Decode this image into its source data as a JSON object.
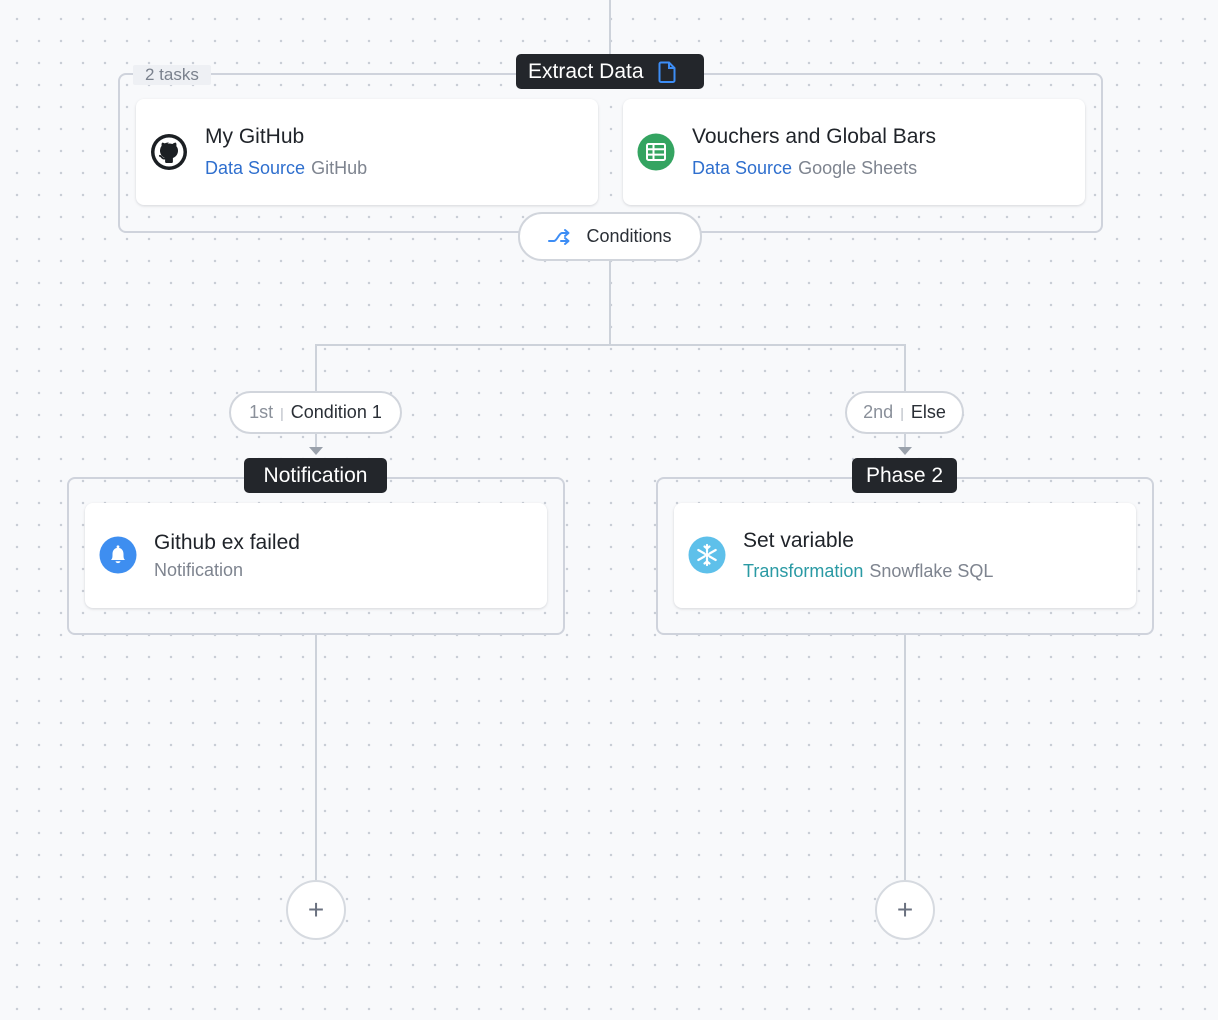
{
  "phases": {
    "extract": {
      "title": "Extract Data",
      "task_count": "2 tasks",
      "tasks": [
        {
          "title": "My GitHub",
          "kind": "Data Source",
          "component": "GitHub",
          "icon": "github-icon"
        },
        {
          "title": "Vouchers and Global Bars",
          "kind": "Data Source",
          "component": "Google Sheets",
          "icon": "google-sheets-icon"
        }
      ]
    },
    "notification": {
      "title": "Notification",
      "tasks": [
        {
          "title": "Github ex failed",
          "kind": "Notification",
          "icon": "bell-icon"
        }
      ]
    },
    "phase2": {
      "title": "Phase 2",
      "tasks": [
        {
          "title": "Set variable",
          "kind": "Transformation",
          "component": "Snowflake SQL",
          "icon": "snowflake-icon"
        }
      ]
    }
  },
  "conditions": {
    "label": "Conditions",
    "icon": "shuffle-icon"
  },
  "branches": [
    {
      "order": "1st",
      "label": "Condition 1"
    },
    {
      "order": "2nd",
      "label": "Else"
    }
  ],
  "add_button": {
    "symbol": "+",
    "icon": "plus-icon"
  },
  "colors": {
    "accent_blue": "#2f6fce",
    "accent_teal": "#2a9aa4",
    "phase_title_bg": "#23262b",
    "connector": "#cdd2da",
    "sheets_green": "#34a461",
    "bell_blue": "#3e8ef0",
    "snowflake_blue": "#5ec0ea"
  }
}
